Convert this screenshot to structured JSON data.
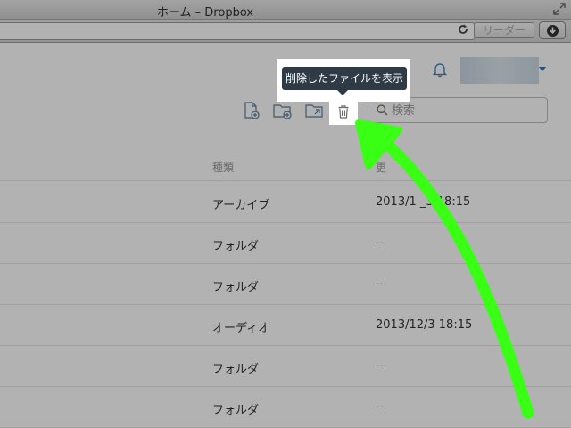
{
  "window": {
    "title": "ホーム – Dropbox"
  },
  "toolbar": {
    "reader_label": "リーダー"
  },
  "search": {
    "placeholder": "検索"
  },
  "tooltip": {
    "text": "削除したファイルを表示"
  },
  "icons": {
    "reload": "reload-icon",
    "download": "download-icon",
    "fullscreen": "fullscreen-icon",
    "bell": "bell-icon",
    "new_file": "new-file-icon",
    "new_folder": "new-folder-icon",
    "shared_folder": "shared-folder-icon",
    "trash": "trash-icon",
    "search": "search-icon"
  },
  "table": {
    "columns": [
      "種類",
      "更"
    ],
    "rows": [
      {
        "kind": "アーカイブ",
        "modified": "2013/1 _3 18:15"
      },
      {
        "kind": "フォルダ",
        "modified": "--"
      },
      {
        "kind": "フォルダ",
        "modified": "--"
      },
      {
        "kind": "オーディオ",
        "modified": "2013/12/3 18:15"
      },
      {
        "kind": "フォルダ",
        "modified": "--"
      },
      {
        "kind": "フォルダ",
        "modified": "--"
      }
    ]
  },
  "colors": {
    "accent": "#1f7ed6",
    "arrow": "#39ff14",
    "tooltip_bg": "#2e3a45"
  }
}
